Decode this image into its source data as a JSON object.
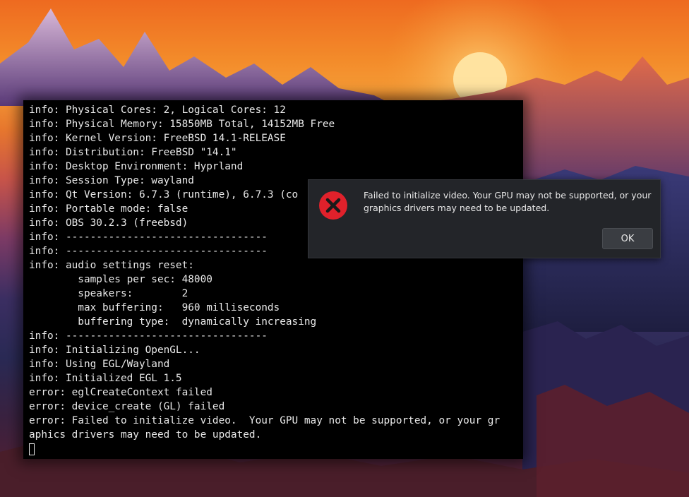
{
  "terminal": {
    "lines": [
      "info: Physical Cores: 2, Logical Cores: 12",
      "info: Physical Memory: 15850MB Total, 14152MB Free",
      "info: Kernel Version: FreeBSD 14.1-RELEASE",
      "info: Distribution: FreeBSD \"14.1\"",
      "info: Desktop Environment: Hyprland",
      "info: Session Type: wayland",
      "info: Qt Version: 6.7.3 (runtime), 6.7.3 (co",
      "info: Portable mode: false",
      "info: OBS 30.2.3 (freebsd)",
      "info: ---------------------------------",
      "info: ---------------------------------",
      "info: audio settings reset:",
      "        samples per sec: 48000",
      "        speakers:        2",
      "        max buffering:   960 milliseconds",
      "        buffering type:  dynamically increasing",
      "info: ---------------------------------",
      "info: Initializing OpenGL...",
      "info: Using EGL/Wayland",
      "info: Initialized EGL 1.5",
      "error: eglCreateContext failed",
      "error: device_create (GL) failed",
      "error: Failed to initialize video.  Your GPU may not be supported, or your gr",
      "aphics drivers may need to be updated."
    ]
  },
  "dialog": {
    "message": "Failed to initialize video.  Your GPU may not be supported, or your graphics drivers may need to be updated.",
    "ok_label": "OK",
    "icon": "error-icon"
  },
  "colors": {
    "dialog_bg": "#232529",
    "error_red": "#e0212b",
    "terminal_bg": "#000000",
    "terminal_fg": "#e8e8e8"
  }
}
